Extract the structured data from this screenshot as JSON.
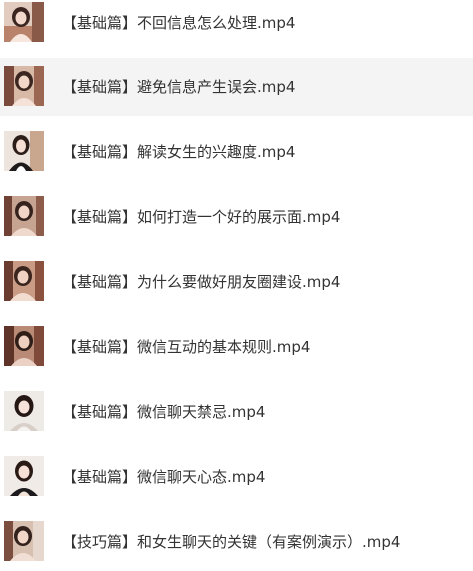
{
  "files": [
    {
      "name": "【基础篇】不回信息怎么处理.mp4",
      "thumbnail_icon": "video-thumbnail-icon",
      "highlighted": false
    },
    {
      "name": "【基础篇】避免信息产生误会.mp4",
      "thumbnail_icon": "video-thumbnail-icon",
      "highlighted": true
    },
    {
      "name": "【基础篇】解读女生的兴趣度.mp4",
      "thumbnail_icon": "video-thumbnail-icon",
      "highlighted": false
    },
    {
      "name": "【基础篇】如何打造一个好的展示面.mp4",
      "thumbnail_icon": "video-thumbnail-icon",
      "highlighted": false
    },
    {
      "name": "【基础篇】为什么要做好朋友圈建设.mp4",
      "thumbnail_icon": "video-thumbnail-icon",
      "highlighted": false
    },
    {
      "name": "【基础篇】微信互动的基本规则.mp4",
      "thumbnail_icon": "video-thumbnail-icon",
      "highlighted": false
    },
    {
      "name": "【基础篇】微信聊天禁忌.mp4",
      "thumbnail_icon": "video-thumbnail-icon",
      "highlighted": false
    },
    {
      "name": "【基础篇】微信聊天心态.mp4",
      "thumbnail_icon": "video-thumbnail-icon",
      "highlighted": false
    },
    {
      "name": "【技巧篇】和女生聊天的关键（有案例演示）.mp4",
      "thumbnail_icon": "video-thumbnail-icon",
      "highlighted": false
    }
  ],
  "colors": {
    "highlight_background": "#f4f4f4",
    "text": "#333333"
  }
}
